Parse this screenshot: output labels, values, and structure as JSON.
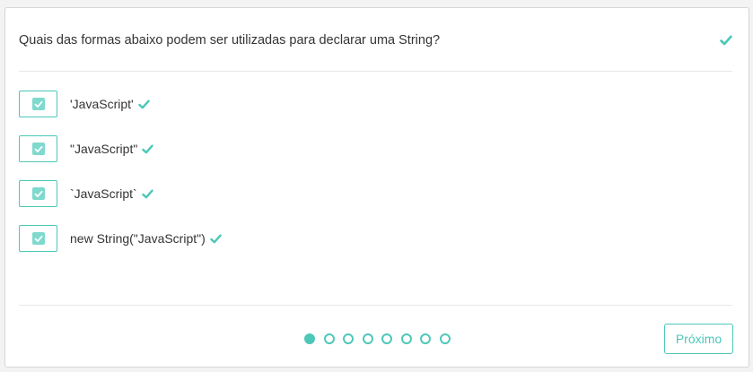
{
  "question": {
    "text": "Quais das formas abaixo podem ser utilizadas para declarar uma String?",
    "status_icon": "check-icon"
  },
  "options": [
    {
      "label": "'JavaScript'",
      "checked": true,
      "correct": true
    },
    {
      "label": "\"JavaScript\"",
      "checked": true,
      "correct": true
    },
    {
      "label": "`JavaScript`",
      "checked": true,
      "correct": true
    },
    {
      "label": "new String(\"JavaScript\")",
      "checked": true,
      "correct": true
    }
  ],
  "pagination": {
    "total": 8,
    "current": 1
  },
  "next_button": {
    "label": "Próximo"
  },
  "colors": {
    "accent": "#4cc7b8",
    "checkbox_fill": "#7fd9cd",
    "text": "#333333",
    "border": "#d6d6d6"
  }
}
